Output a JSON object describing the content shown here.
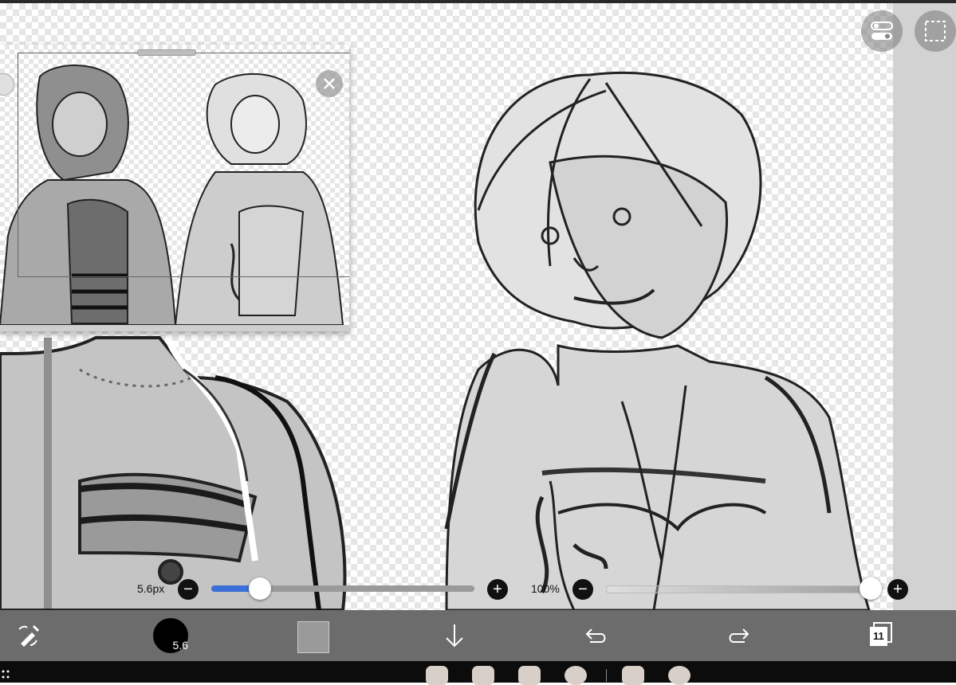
{
  "reference_window": {
    "icons": [
      "camera-icon",
      "close-icon",
      "drag-handle"
    ]
  },
  "brush_size_slider": {
    "value_label": "5.6px",
    "level_fraction": 0.18,
    "minus_icon": "minus-icon",
    "plus_icon": "plus-icon"
  },
  "opacity_slider": {
    "value_label": "100%",
    "level_fraction": 1.0,
    "minus_icon": "minus-icon",
    "plus_icon": "plus-icon"
  },
  "top_right": {
    "icons": [
      "toggle-panels-icon",
      "selection-icon"
    ]
  },
  "toolbar": {
    "brush_size_value": "5.6",
    "layer_count": "11",
    "primary_color": "#000000",
    "secondary_color": "#9a9a9a",
    "icons": [
      "tool-switch-icon",
      "brush-preview",
      "color-swatch",
      "download-icon",
      "undo-icon",
      "redo-icon",
      "layers-icon"
    ]
  },
  "taskbar": {
    "icons": [
      "files-icon",
      "phone-icon",
      "contacts-icon",
      "messages-icon",
      "youtube-icon",
      "chrome-icon"
    ]
  },
  "colors": {
    "accent": "#3a6fd8",
    "toolbar_bg": "#606060",
    "taskbar_bg": "#0c0c0c"
  }
}
